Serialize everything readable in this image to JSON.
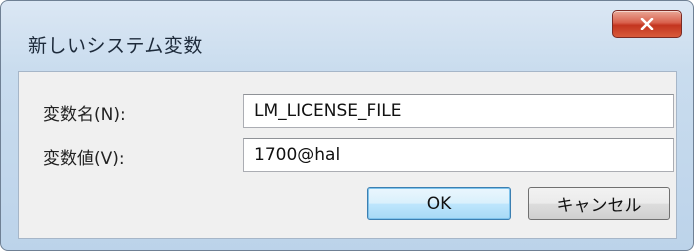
{
  "window": {
    "title": "新しいシステム変数",
    "close_icon": "close-x-icon"
  },
  "form": {
    "name_label": "変数名(N):",
    "name_value": "LM_LICENSE_FILE",
    "value_label": "変数値(V):",
    "value_value": "1700@hal"
  },
  "buttons": {
    "ok_label": "OK",
    "cancel_label": "キャンセル"
  },
  "colors": {
    "close_button": "#c7432b",
    "ok_button_border": "#3c7fb1",
    "window_frame": "#c9dcee"
  }
}
